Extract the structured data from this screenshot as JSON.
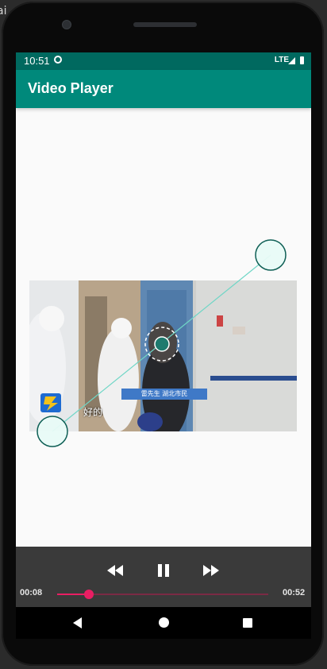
{
  "status_bar": {
    "time": "10:51",
    "network": "LTE"
  },
  "app_bar": {
    "title": "Video Player"
  },
  "video": {
    "caption_badge": "雷先生  湖北市民",
    "subtitle": "好的"
  },
  "player": {
    "current_time": "00:08",
    "total_time": "00:52",
    "progress": 0.15
  },
  "background_fragments": {
    "top_left": "ai"
  },
  "colors": {
    "status_bar": "#00695f",
    "app_bar": "#00897b",
    "accent": "#e91e63"
  }
}
